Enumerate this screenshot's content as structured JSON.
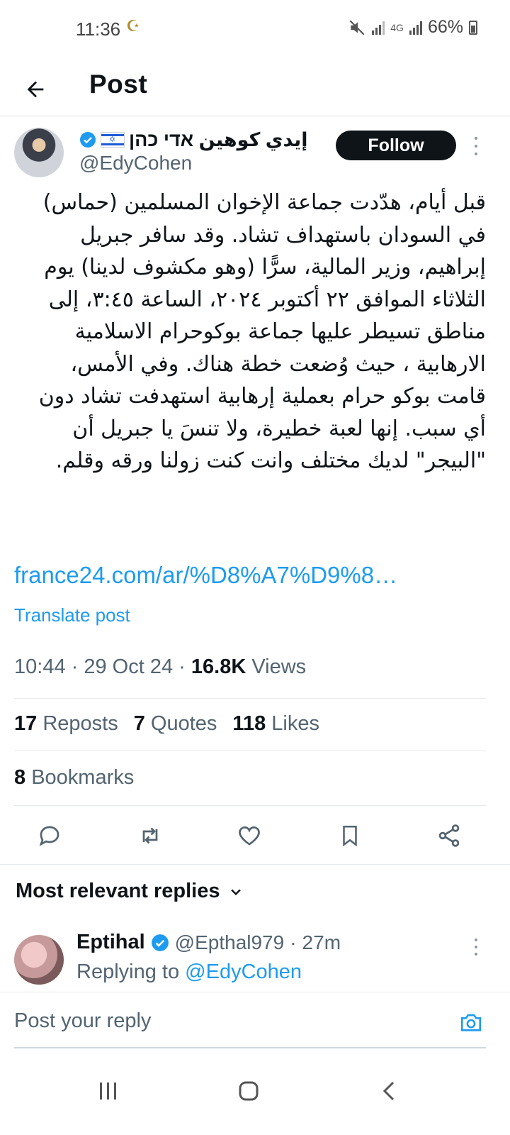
{
  "status": {
    "time": "11:36",
    "extra_icon": "☪",
    "network": "4G",
    "battery": "66%"
  },
  "header": {
    "title": "Post"
  },
  "author": {
    "name": "إيدي كوهين אדי כהן",
    "handle": "@EdyCohen",
    "follow_label": "Follow"
  },
  "post": {
    "lines": [
      "قبل أيام، هدّدت جماعة الإخوان المسلمين (حماس)",
      "في السودان باستهداف تشاد. وقد سافر جبريل",
      "إبراهيم، وزير المالية، سرًّا (وهو مكشوف لدينا) يوم",
      "الثلاثاء الموافق ٢٢ أكتوبر ٢٠٢٤، الساعة ٣:٤٥، إلى",
      "مناطق تسيطر عليها جماعة بوكوحرام  الاسلامية",
      "الارهابية ، حيث وُضعت خطة هناك. وفي الأمس،",
      "قامت بوكو حرام بعملية إرهابية استهدفت تشاد دون",
      "أي سبب. إنها لعبة خطيرة، ولا تنسَ يا جبريل أن",
      "\"البيجر\" لديك مختلف وانت كنت زولنا ورقه وقلم."
    ],
    "link": "france24.com/ar/%D8%A7%D9%8…",
    "translate_label": "Translate post",
    "time": "10:44",
    "date": "29 Oct 24",
    "views_count": "16.8K",
    "views_label": "Views",
    "separator": " · "
  },
  "stats": {
    "reposts_count": "17",
    "reposts_label": "Reposts",
    "quotes_count": "7",
    "quotes_label": "Quotes",
    "likes_count": "118",
    "likes_label": "Likes",
    "bookmarks_count": "8",
    "bookmarks_label": "Bookmarks"
  },
  "replies": {
    "header": "Most relevant replies",
    "items": [
      {
        "name": "Eptihal",
        "handle": "@Epthal979",
        "age": "27m",
        "replying_to_prefix": "Replying to",
        "replying_to": "@EdyCohen"
      }
    ]
  },
  "compose": {
    "placeholder": "Post your reply"
  },
  "colors": {
    "accent": "#1d9bf0",
    "text": "#0f1419",
    "muted": "#536471",
    "follow_bg": "#0f1419"
  }
}
